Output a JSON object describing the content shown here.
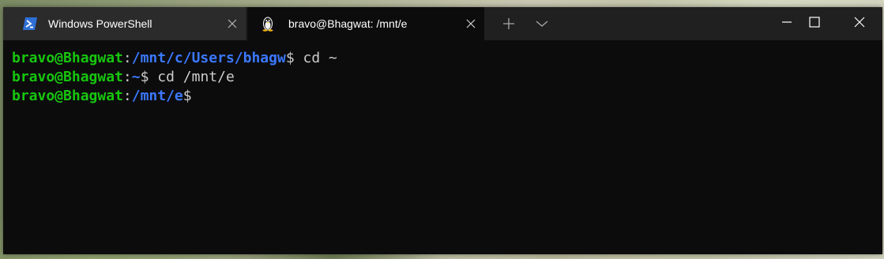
{
  "window": {
    "tabs": [
      {
        "label": "Windows PowerShell",
        "icon": "powershell-icon",
        "active": false
      },
      {
        "label": "bravo@Bhagwat: /mnt/e",
        "icon": "linux-penguin-icon",
        "active": true
      }
    ],
    "controls": {
      "new_tab_icon": "plus-icon",
      "dropdown_icon": "chevron-down-icon",
      "minimize_icon": "minimize-icon",
      "maximize_icon": "maximize-icon",
      "close_icon": "close-icon"
    }
  },
  "terminal": {
    "lines": [
      {
        "user": "bravo@Bhagwat",
        "colon": ":",
        "path": "/mnt/c/Users/bhagw",
        "prompt": "$",
        "command": " cd ~"
      },
      {
        "user": "bravo@Bhagwat",
        "colon": ":",
        "path": "~",
        "prompt": "$",
        "command": " cd /mnt/e"
      },
      {
        "user": "bravo@Bhagwat",
        "colon": ":",
        "path": "/mnt/e",
        "prompt": "$",
        "command": ""
      }
    ]
  },
  "colors": {
    "titlebar": "#202020",
    "inactive_tab": "#2b2b2b",
    "terminal_bg": "#0c0c0c",
    "user_green": "#16c60c",
    "path_blue": "#3b78ff",
    "text": "#cccccc"
  }
}
